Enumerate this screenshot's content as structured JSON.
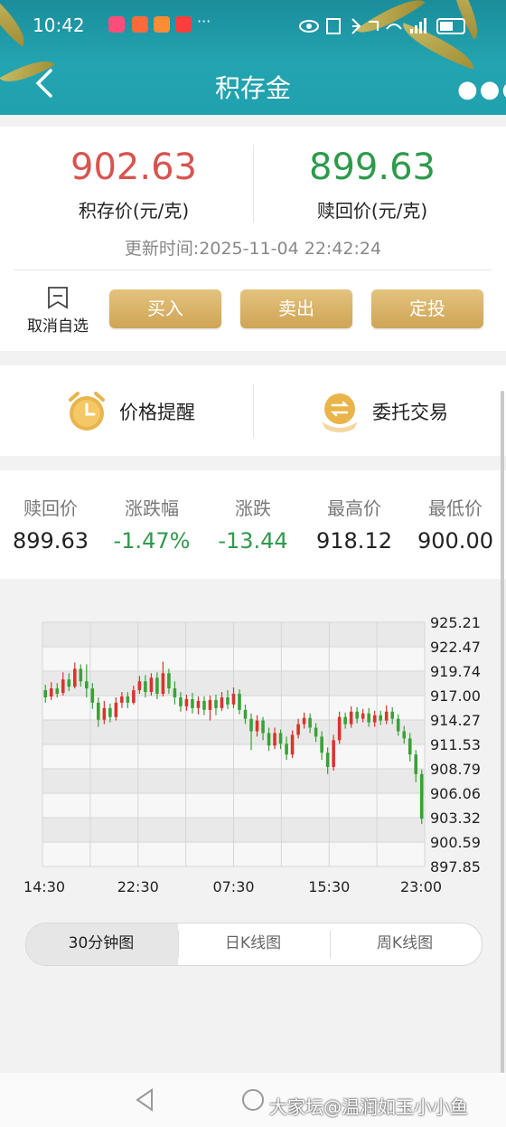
{
  "status_bar": {
    "time": "10:42",
    "overflow": "···"
  },
  "header": {
    "title": "积存金"
  },
  "prices": {
    "buy_value": "902.63",
    "buy_label": "积存价(元/克)",
    "sell_value": "899.63",
    "sell_label": "赎回价(元/克)",
    "update_time": "更新时间:2025-11-04 22:42:24"
  },
  "actions": {
    "unwatch_label": "取消自选",
    "buy": "买入",
    "sell": "卖出",
    "invest": "定投"
  },
  "features": {
    "alert": "价格提醒",
    "delegate": "委托交易"
  },
  "stats": {
    "labels": [
      "赎回价",
      "涨跌幅",
      "涨跌",
      "最高价",
      "最低价"
    ],
    "values": [
      "899.63",
      "-1.47%",
      "-13.44",
      "918.12",
      "900.00"
    ]
  },
  "chart_data": {
    "type": "candlestick",
    "y_ticks": [
      "925.21",
      "922.47",
      "919.74",
      "917.00",
      "914.27",
      "911.53",
      "908.79",
      "906.06",
      "903.32",
      "900.59",
      "897.85"
    ],
    "ylim": [
      897.85,
      925.21
    ],
    "x_ticks": [
      "14:30",
      "22:30",
      "07:30",
      "15:30",
      "23:00"
    ],
    "candles": [
      {
        "o": 917.6,
        "c": 916.8,
        "h": 918.2,
        "l": 916.2
      },
      {
        "o": 916.9,
        "c": 917.8,
        "h": 918.5,
        "l": 916.5
      },
      {
        "o": 917.8,
        "c": 917.2,
        "h": 918.4,
        "l": 916.8
      },
      {
        "o": 917.3,
        "c": 918.8,
        "h": 919.6,
        "l": 917.0
      },
      {
        "o": 918.8,
        "c": 918.0,
        "h": 919.5,
        "l": 917.5
      },
      {
        "o": 918.0,
        "c": 920.0,
        "h": 920.7,
        "l": 917.8
      },
      {
        "o": 920.0,
        "c": 918.6,
        "h": 920.5,
        "l": 918.0
      },
      {
        "o": 918.6,
        "c": 917.8,
        "h": 920.5,
        "l": 916.8
      },
      {
        "o": 917.8,
        "c": 916.2,
        "h": 918.4,
        "l": 915.5
      },
      {
        "o": 916.2,
        "c": 914.3,
        "h": 916.8,
        "l": 913.5
      },
      {
        "o": 914.3,
        "c": 915.6,
        "h": 916.4,
        "l": 913.8
      },
      {
        "o": 915.6,
        "c": 914.6,
        "h": 916.1,
        "l": 914.0
      },
      {
        "o": 914.6,
        "c": 916.2,
        "h": 916.8,
        "l": 914.2
      },
      {
        "o": 916.2,
        "c": 916.9,
        "h": 917.4,
        "l": 915.6
      },
      {
        "o": 916.9,
        "c": 916.2,
        "h": 917.4,
        "l": 915.6
      },
      {
        "o": 916.2,
        "c": 917.6,
        "h": 918.1,
        "l": 916.0
      },
      {
        "o": 917.6,
        "c": 918.6,
        "h": 919.2,
        "l": 917.2
      },
      {
        "o": 918.6,
        "c": 917.4,
        "h": 919.3,
        "l": 916.8
      },
      {
        "o": 917.4,
        "c": 919.0,
        "h": 919.5,
        "l": 917.0
      },
      {
        "o": 919.0,
        "c": 917.2,
        "h": 919.6,
        "l": 916.6
      },
      {
        "o": 917.2,
        "c": 919.5,
        "h": 920.8,
        "l": 916.9
      },
      {
        "o": 919.5,
        "c": 917.8,
        "h": 920.0,
        "l": 917.2
      },
      {
        "o": 917.8,
        "c": 916.8,
        "h": 918.6,
        "l": 916.0
      },
      {
        "o": 916.8,
        "c": 915.8,
        "h": 917.4,
        "l": 915.2
      },
      {
        "o": 915.8,
        "c": 916.6,
        "h": 917.1,
        "l": 915.3
      },
      {
        "o": 916.6,
        "c": 915.6,
        "h": 917.3,
        "l": 915.0
      },
      {
        "o": 915.6,
        "c": 916.4,
        "h": 916.9,
        "l": 914.9
      },
      {
        "o": 916.4,
        "c": 915.4,
        "h": 916.9,
        "l": 914.8
      },
      {
        "o": 915.4,
        "c": 916.5,
        "h": 917.0,
        "l": 914.2
      },
      {
        "o": 916.5,
        "c": 915.6,
        "h": 917.1,
        "l": 914.8
      },
      {
        "o": 915.6,
        "c": 916.8,
        "h": 917.4,
        "l": 915.3
      },
      {
        "o": 916.8,
        "c": 916.0,
        "h": 917.6,
        "l": 915.5
      },
      {
        "o": 916.0,
        "c": 917.2,
        "h": 917.9,
        "l": 915.6
      },
      {
        "o": 917.2,
        "c": 915.4,
        "h": 917.7,
        "l": 914.9
      },
      {
        "o": 915.4,
        "c": 914.4,
        "h": 916.0,
        "l": 913.8
      },
      {
        "o": 914.4,
        "c": 913.0,
        "h": 915.0,
        "l": 910.9
      },
      {
        "o": 913.0,
        "c": 914.2,
        "h": 914.8,
        "l": 912.4
      },
      {
        "o": 914.2,
        "c": 912.8,
        "h": 914.6,
        "l": 912.0
      },
      {
        "o": 912.8,
        "c": 911.4,
        "h": 913.4,
        "l": 910.8
      },
      {
        "o": 911.4,
        "c": 912.8,
        "h": 913.4,
        "l": 911.0
      },
      {
        "o": 912.8,
        "c": 911.6,
        "h": 913.2,
        "l": 911.0
      },
      {
        "o": 911.6,
        "c": 910.4,
        "h": 912.4,
        "l": 909.8
      },
      {
        "o": 910.4,
        "c": 912.6,
        "h": 913.1,
        "l": 910.0
      },
      {
        "o": 912.6,
        "c": 913.8,
        "h": 914.4,
        "l": 912.2
      },
      {
        "o": 913.8,
        "c": 914.5,
        "h": 915.1,
        "l": 913.3
      },
      {
        "o": 914.5,
        "c": 913.4,
        "h": 915.0,
        "l": 912.8
      },
      {
        "o": 913.4,
        "c": 912.4,
        "h": 913.9,
        "l": 911.8
      },
      {
        "o": 912.4,
        "c": 910.6,
        "h": 913.0,
        "l": 909.8
      },
      {
        "o": 910.6,
        "c": 909.0,
        "h": 911.2,
        "l": 908.2
      },
      {
        "o": 909.0,
        "c": 912.0,
        "h": 912.6,
        "l": 908.6
      },
      {
        "o": 912.0,
        "c": 914.6,
        "h": 915.2,
        "l": 911.6
      },
      {
        "o": 914.6,
        "c": 913.8,
        "h": 915.1,
        "l": 913.3
      },
      {
        "o": 913.8,
        "c": 915.2,
        "h": 915.8,
        "l": 913.4
      },
      {
        "o": 915.2,
        "c": 914.4,
        "h": 915.7,
        "l": 913.9
      },
      {
        "o": 914.4,
        "c": 915.0,
        "h": 915.5,
        "l": 914.0
      },
      {
        "o": 915.0,
        "c": 914.0,
        "h": 915.6,
        "l": 913.5
      },
      {
        "o": 914.0,
        "c": 914.8,
        "h": 915.3,
        "l": 913.5
      },
      {
        "o": 914.8,
        "c": 914.2,
        "h": 915.3,
        "l": 913.7
      },
      {
        "o": 914.2,
        "c": 915.2,
        "h": 915.9,
        "l": 913.8
      },
      {
        "o": 915.2,
        "c": 914.4,
        "h": 915.7,
        "l": 913.8
      },
      {
        "o": 914.4,
        "c": 913.0,
        "h": 914.9,
        "l": 912.5
      },
      {
        "o": 913.0,
        "c": 912.2,
        "h": 913.6,
        "l": 911.6
      },
      {
        "o": 912.2,
        "c": 910.4,
        "h": 912.8,
        "l": 909.6
      },
      {
        "o": 910.4,
        "c": 908.2,
        "h": 910.9,
        "l": 907.3
      },
      {
        "o": 908.2,
        "c": 903.2,
        "h": 908.7,
        "l": 902.6
      }
    ]
  },
  "chart_tabs": [
    "30分钟图",
    "日K线图",
    "周K线图"
  ],
  "nav": {
    "watermark": "大家坛@温润如玉小小鱼"
  },
  "colors": {
    "up": "#d9342b",
    "down": "#3aa137",
    "gold": "#d4ab5f",
    "teal": "#1f98a6"
  }
}
